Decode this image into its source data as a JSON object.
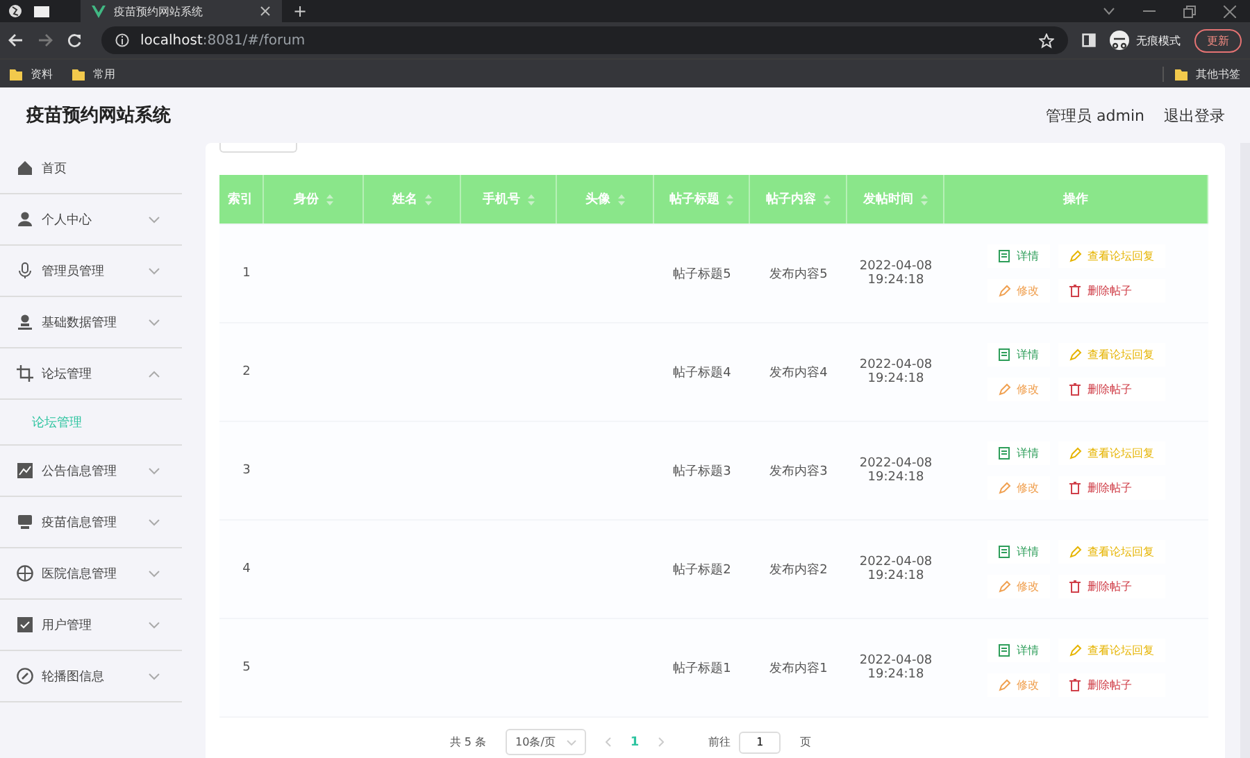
{
  "browser": {
    "tab_title": "疫苗预约网站系统",
    "new_tab": "+",
    "url_host": "localhost",
    "url_path": ":8081/#/forum",
    "profile": "无痕模式",
    "update": "更新",
    "bookmarks": [
      "资料",
      "常用"
    ],
    "other_bookmarks": "其他书签"
  },
  "header": {
    "title": "疫苗预约网站系统",
    "user": "管理员 admin",
    "logout": "退出登录"
  },
  "sidebar": {
    "items": [
      {
        "label": "首页"
      },
      {
        "label": "个人中心",
        "expanded": false
      },
      {
        "label": "管理员管理",
        "expanded": false
      },
      {
        "label": "基础数据管理",
        "expanded": false
      },
      {
        "label": "论坛管理",
        "expanded": true,
        "children": [
          {
            "label": "论坛管理",
            "selected": true
          }
        ]
      },
      {
        "label": "公告信息管理",
        "expanded": false
      },
      {
        "label": "疫苗信息管理",
        "expanded": false
      },
      {
        "label": "医院信息管理",
        "expanded": false
      },
      {
        "label": "用户管理",
        "expanded": false
      },
      {
        "label": "轮播图信息",
        "expanded": false
      }
    ]
  },
  "table": {
    "columns": [
      {
        "label": "索引",
        "sortable": false
      },
      {
        "label": "身份",
        "sortable": true
      },
      {
        "label": "姓名",
        "sortable": true
      },
      {
        "label": "手机号",
        "sortable": true
      },
      {
        "label": "头像",
        "sortable": true
      },
      {
        "label": "帖子标题",
        "sortable": true
      },
      {
        "label": "帖子内容",
        "sortable": true
      },
      {
        "label": "发帖时间",
        "sortable": true
      },
      {
        "label": "操作",
        "sortable": false
      }
    ],
    "rows": [
      {
        "index": "1",
        "title": "帖子标题5",
        "content": "发布内容5",
        "time": "2022-04-08 19:24:18",
        "actions": [
          {
            "kind": "detail",
            "label": "详情"
          },
          {
            "kind": "replies",
            "label": "查看论坛回复"
          },
          {
            "kind": "edit",
            "label": "修改"
          },
          {
            "kind": "delete",
            "label": "删除帖子"
          }
        ]
      },
      {
        "index": "2",
        "title": "帖子标题4",
        "content": "发布内容4",
        "time": "2022-04-08 19:24:18",
        "actions": [
          {
            "kind": "detail",
            "label": "详情"
          },
          {
            "kind": "replies",
            "label": "查看论坛回复"
          },
          {
            "kind": "edit",
            "label": "修改"
          },
          {
            "kind": "delete",
            "label": "删除帖子"
          }
        ]
      },
      {
        "index": "3",
        "title": "帖子标题3",
        "content": "发布内容3",
        "time": "2022-04-08 19:24:18",
        "actions": [
          {
            "kind": "detail",
            "label": "详情"
          },
          {
            "kind": "replies",
            "label": "查看论坛回复"
          },
          {
            "kind": "edit",
            "label": "修改"
          },
          {
            "kind": "delete",
            "label": "删除帖子"
          }
        ]
      },
      {
        "index": "4",
        "title": "帖子标题2",
        "content": "发布内容2",
        "time": "2022-04-08 19:24:18",
        "actions": [
          {
            "kind": "detail",
            "label": "详情"
          },
          {
            "kind": "replies",
            "label": "查看论坛回复"
          },
          {
            "kind": "edit",
            "label": "修改"
          },
          {
            "kind": "delete",
            "label": "删除帖子"
          }
        ]
      },
      {
        "index": "5",
        "title": "帖子标题1",
        "content": "发布内容1",
        "time": "2022-04-08 19:24:18",
        "actions": [
          {
            "kind": "detail",
            "label": "详情"
          },
          {
            "kind": "replies",
            "label": "查看论坛回复"
          },
          {
            "kind": "edit",
            "label": "修改"
          },
          {
            "kind": "delete",
            "label": "删除帖子"
          }
        ]
      }
    ]
  },
  "pagination": {
    "total": "共 5 条",
    "page_size": "10条/页",
    "pages": [
      {
        "label": "1",
        "selected": true
      }
    ],
    "goto_label": "前往",
    "goto_value": "1",
    "goto_suffix": "页"
  }
}
